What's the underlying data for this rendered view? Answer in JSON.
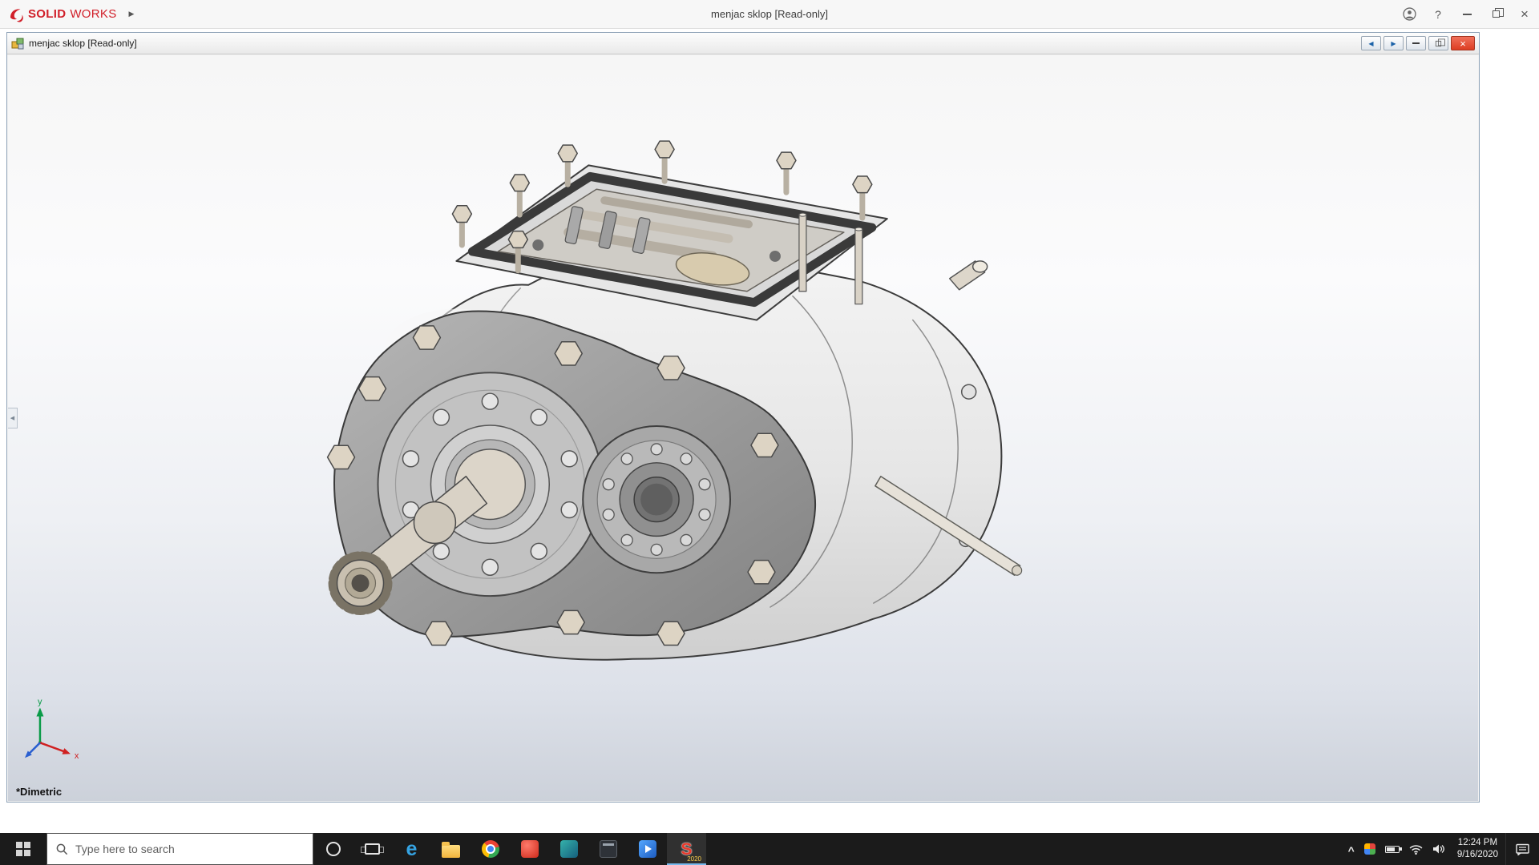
{
  "app": {
    "brand": {
      "solid": "SOLID",
      "works": "WORKS",
      "arrow": "▶",
      "logo_icon": "solidworks-logo"
    },
    "title": "menjac sklop [Read-only]",
    "controls": {
      "user_icon": "user-profile",
      "help": "?",
      "close": "×"
    }
  },
  "doc": {
    "icon": "assembly-document-icon",
    "title": "menjac sklop [Read-only]",
    "controls": {
      "pane_left": "◀",
      "pane_right": "▶",
      "close": "×"
    },
    "panel_tab": "◀",
    "view_label": "*Dimetric",
    "triad": {
      "x": "x",
      "y": "y"
    }
  },
  "taskbar": {
    "start_icon": "windows-start",
    "search": {
      "placeholder": "Type here to search",
      "icon": "search-magnifier"
    },
    "apps": [
      {
        "name": "cortana"
      },
      {
        "name": "task-view"
      },
      {
        "name": "microsoft-edge",
        "glyph": "e"
      },
      {
        "name": "file-explorer"
      },
      {
        "name": "google-chrome"
      },
      {
        "name": "app-red"
      },
      {
        "name": "app-teal"
      },
      {
        "name": "app-dark"
      },
      {
        "name": "app-blue"
      },
      {
        "name": "solidworks-2020",
        "glyph": "S",
        "badge": "2020",
        "active": true
      }
    ],
    "tray": {
      "caret": "^",
      "icons": [
        "tray-app",
        "battery",
        "wifi",
        "volume"
      ],
      "time": "12:24 PM",
      "date": "9/16/2020",
      "notification_icon": "action-center"
    }
  },
  "colors": {
    "brand_red": "#d1202a",
    "doc_close_red": "#dd3d22",
    "taskbar_bg": "#1b1b1b",
    "active_accent": "#76b9ed",
    "viewport_gradient_bottom": "#ccd1da"
  }
}
